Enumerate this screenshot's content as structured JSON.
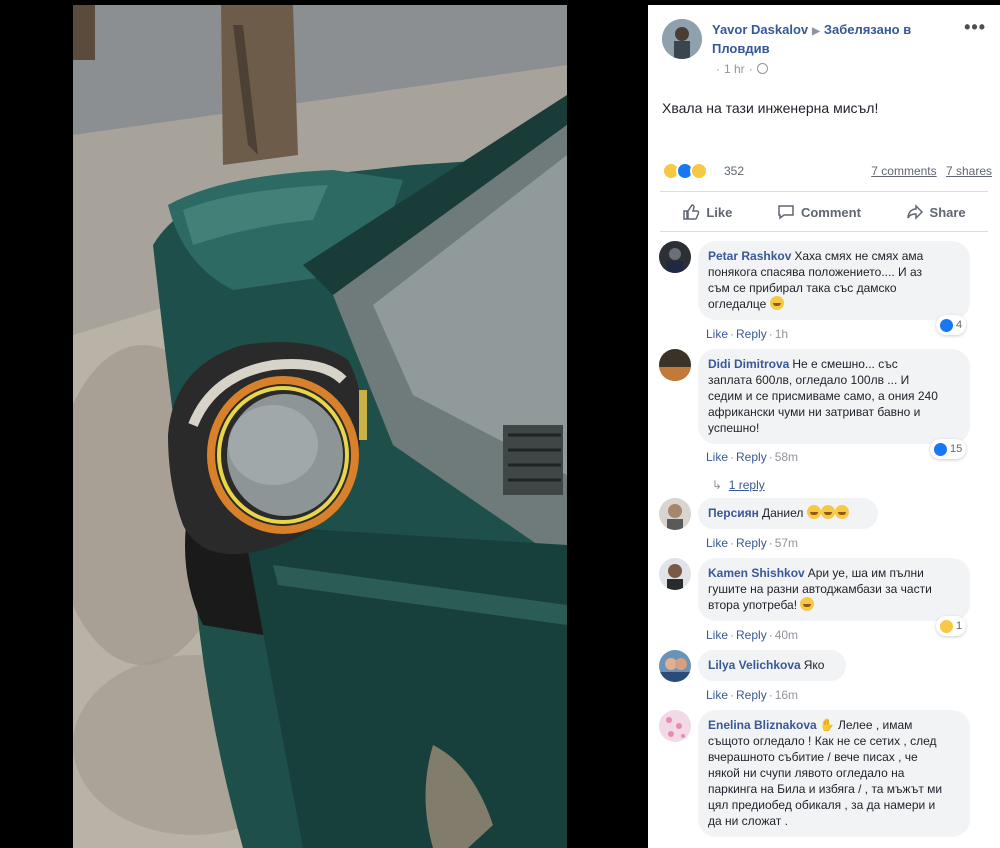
{
  "post": {
    "author": "Yavor Daskalov",
    "location": "Забелязано в Пловдив",
    "time": "1 hr",
    "text": "Хвала на тази инженерна мисъл!",
    "reaction_count": "352",
    "comments_count": "7 comments",
    "shares_count": "7 shares"
  },
  "actions": {
    "like": "Like",
    "comment": "Comment",
    "share": "Share"
  },
  "comments": [
    {
      "author": "Petar Rashkov",
      "text_lines": [
        "Хаха смях не смях ама",
        "понякога спасява положението.... И аз",
        "съм се прибирал така със дамско",
        "огледалце"
      ],
      "like": "Like",
      "reply": "Reply",
      "time": "1h",
      "reactions": "4"
    },
    {
      "author": "Didi Dimitrova",
      "text_lines": [
        "Не е смешно... със",
        "заплата 600лв, огледало 100лв ... И",
        "седим и се присмиваме само, а ония 240",
        "африкански чуми ни затриват бавно и",
        "успешно!"
      ],
      "like": "Like",
      "reply": "Reply",
      "time": "58m",
      "reactions": "15",
      "replies": "1 reply"
    },
    {
      "author": "Персиян",
      "text_lines": [
        "Даниел"
      ],
      "like": "Like",
      "reply": "Reply",
      "time": "57m"
    },
    {
      "author": "Kamen Shishkov",
      "text_lines": [
        "Ари уе, ша им пълни",
        "гушите на разни автоджамбази за части",
        "втора употреба!"
      ],
      "like": "Like",
      "reply": "Reply",
      "time": "40m",
      "reactions": "1"
    },
    {
      "author": "Lilya Velichkova",
      "text_lines": [
        "Яко"
      ],
      "like": "Like",
      "reply": "Reply",
      "time": "16m"
    },
    {
      "author": "Enelina Bliznakova",
      "text_lines": [
        "Лелее , имам",
        "същото огледало ! Как не се сетих , след",
        "вчерашното събитие / вече писах , че",
        "някой ни счупи лявото огледало на",
        "паркинга на Била и избяга / , та мъжът ми",
        "цял предиобед обикаля , за да намери и",
        "да ни сложат ."
      ]
    }
  ],
  "colors": {
    "link": "#385898",
    "muted": "#90949c",
    "bubble": "#f2f3f5",
    "like_blue": "#1877f2",
    "reaction_yellow": "#f7c844"
  }
}
